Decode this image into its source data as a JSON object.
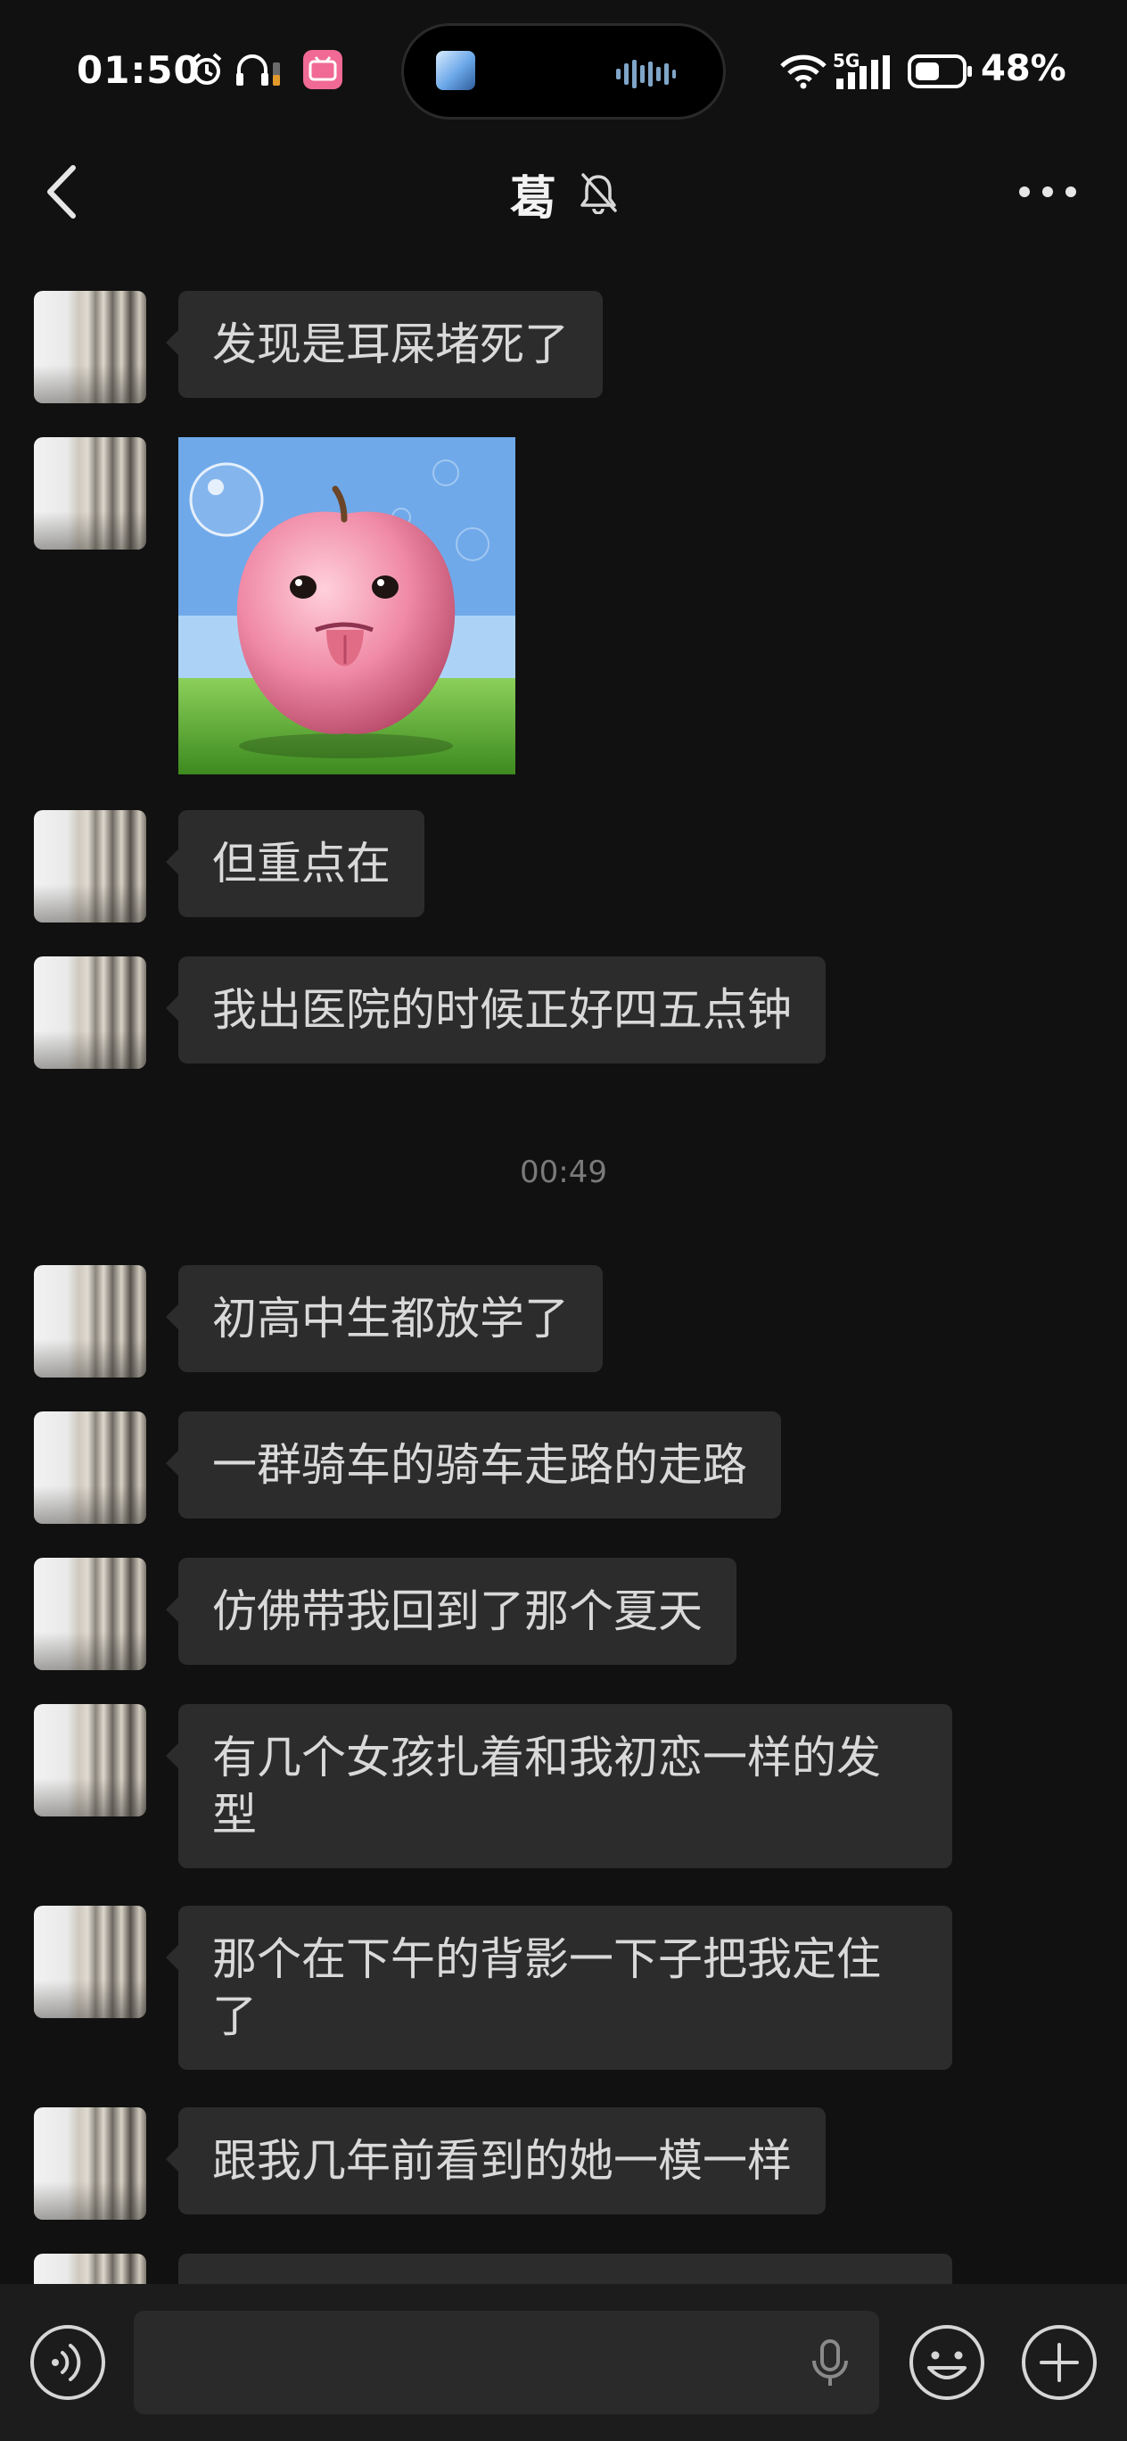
{
  "status_bar": {
    "time": "01:50",
    "network": "5G",
    "battery": "48%",
    "icons": [
      "alarm-icon",
      "headphones-icon",
      "bilibili-icon",
      "wifi-icon",
      "signal-icon",
      "battery-icon"
    ]
  },
  "header": {
    "title": "葛",
    "icons": [
      "back-icon",
      "mute-bell-icon",
      "more-icon"
    ]
  },
  "messages": [
    {
      "type": "text",
      "text": "发现是耳屎堵死了"
    },
    {
      "type": "sticker",
      "description_icon": "apple-sticker"
    },
    {
      "type": "text",
      "text": "但重点在"
    },
    {
      "type": "text",
      "text": "我出医院的时候正好四五点钟"
    },
    {
      "type": "timestamp",
      "text": "00:49"
    },
    {
      "type": "text",
      "text": "初高中生都放学了"
    },
    {
      "type": "text",
      "text": "一群骑车的骑车走路的走路"
    },
    {
      "type": "text",
      "text": "仿佛带我回到了那个夏天"
    },
    {
      "type": "text",
      "text": "有几个女孩扎着和我初恋一样的发型"
    },
    {
      "type": "text",
      "text": "那个在下午的背影一下子把我定住了"
    },
    {
      "type": "text",
      "text": "跟我几年前看到的她一模一样"
    }
  ],
  "input_bar": {
    "placeholder": "",
    "icons": [
      "voice-mode-icon",
      "mic-icon",
      "emoji-icon",
      "plus-icon"
    ]
  },
  "colors": {
    "background": "#111111",
    "bubble": "#2c2c2c",
    "text": "#d9d9d9",
    "timestamp": "#7a7a7a",
    "input_bar": "#1c1c1c"
  }
}
